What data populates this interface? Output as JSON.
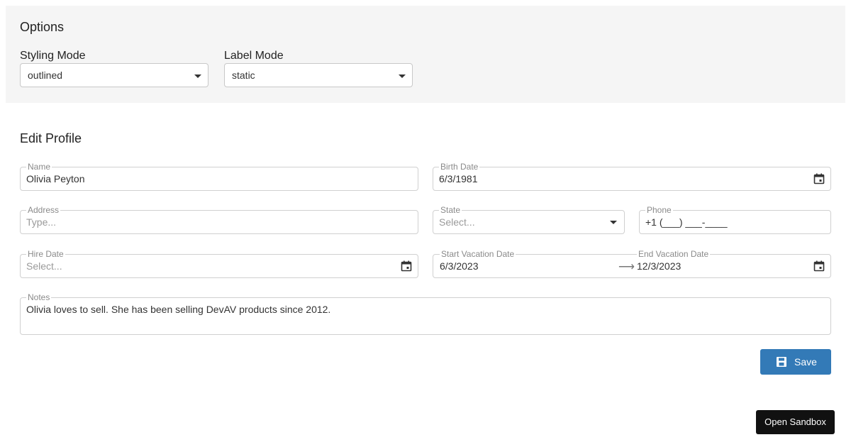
{
  "options": {
    "title": "Options",
    "styling_mode_label": "Styling Mode",
    "styling_mode_value": "outlined",
    "label_mode_label": "Label Mode",
    "label_mode_value": "static"
  },
  "form": {
    "title": "Edit Profile",
    "name_label": "Name",
    "name_value": "Olivia Peyton",
    "birth_date_label": "Birth Date",
    "birth_date_value": "6/3/1981",
    "address_label": "Address",
    "address_placeholder": "Type...",
    "state_label": "State",
    "state_placeholder": "Select...",
    "phone_label": "Phone",
    "phone_value": "+1 (___) ___-____",
    "hire_date_label": "Hire Date",
    "hire_date_placeholder": "Select...",
    "start_vacation_label": "Start Vacation Date",
    "start_vacation_value": "6/3/2023",
    "end_vacation_label": "End Vacation Date",
    "end_vacation_value": "12/3/2023",
    "notes_label": "Notes",
    "notes_value": "Olivia loves to sell. She has been selling DevAV products since 2012."
  },
  "actions": {
    "save_label": "Save",
    "sandbox_label": "Open Sandbox"
  },
  "icons": {
    "calendar": "calendar-icon",
    "dropdown": "chevron-down-icon",
    "save": "floppy-disk-icon",
    "range_arrow": "arrow-right-icon"
  },
  "colors": {
    "accent": "#337ab7",
    "options_bg": "#f5f5f5",
    "sandbox_bg": "#111111"
  }
}
